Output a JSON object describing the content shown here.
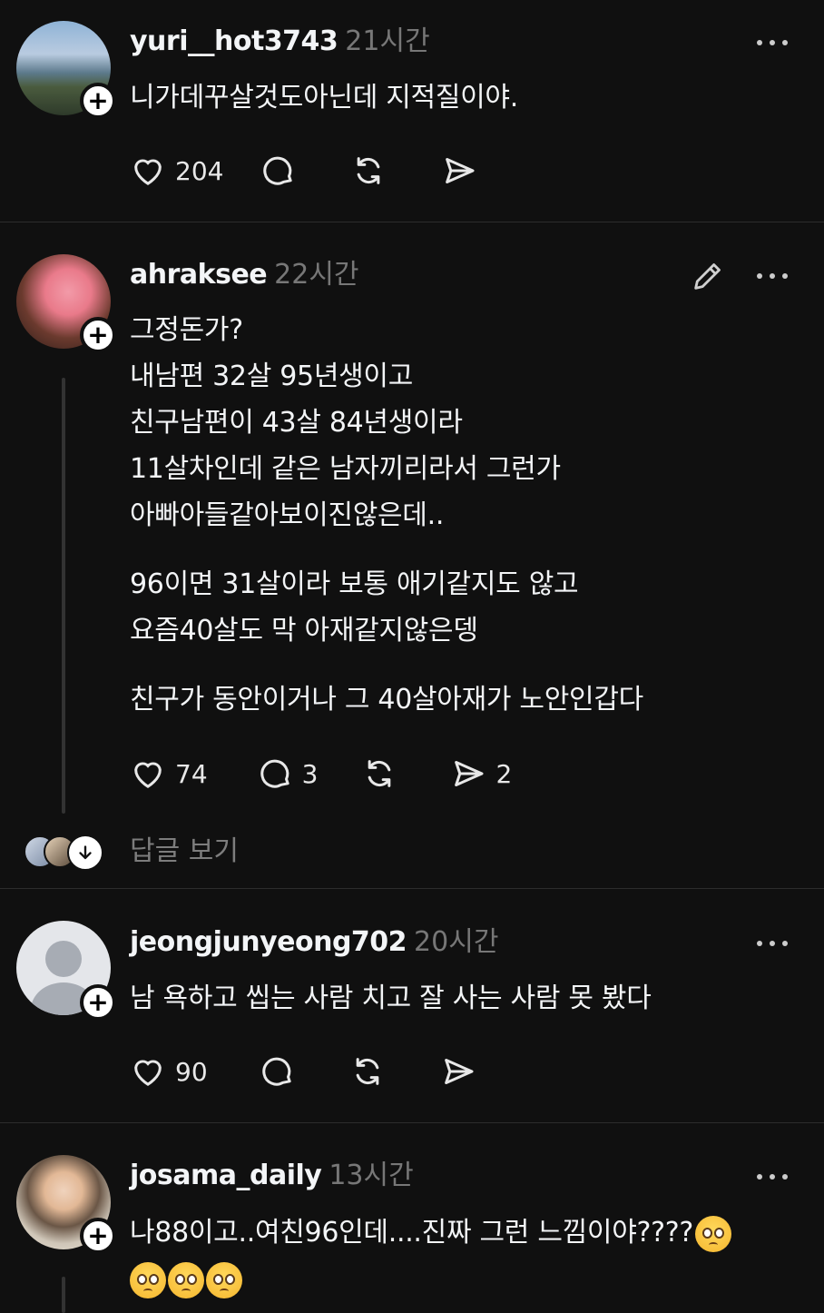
{
  "posts": [
    {
      "username": "yuri__hot3743",
      "time": "21시간",
      "lines": [
        "니가데꾸살것도아닌데  지적질이야."
      ],
      "likes": "204"
    },
    {
      "username": "ahraksee",
      "time": "22시간",
      "lines": [
        "그정돈가?",
        "내남편 32살 95년생이고",
        "친구남편이 43살 84년생이라",
        "11살차인데 같은 남자끼리라서 그런가",
        "아빠아들같아보이진않은데..",
        "96이면 31살이라 보통 애기같지도 않고",
        "요즘40살도 막 아재같지않은뎅",
        "친구가 동안이거나 그 40살아재가 노안인갑다"
      ],
      "likes": "74",
      "replies": "3",
      "shares": "2",
      "view_replies": "답글 보기"
    },
    {
      "username": "jeongjunyeong702",
      "time": "20시간",
      "lines": [
        "남 욕하고 씹는 사람 치고 잘 사는 사람 못 봤다"
      ],
      "likes": "90"
    },
    {
      "username": "josama_daily",
      "time": "13시간",
      "lines": [
        "나88이고..여친96인데....진짜 그런 느낌이야????"
      ]
    }
  ],
  "icons": {
    "like": "heart-icon",
    "reply": "comment-icon",
    "repost": "repost-icon",
    "share": "send-icon",
    "more": "more-icon",
    "edit": "pencil-icon",
    "follow": "plus-icon",
    "emoji": "pleading-face-emoji"
  },
  "colors": {
    "background": "#101010",
    "text": "#f3f5f7",
    "muted": "#777777",
    "divider": "#2c2c2c"
  }
}
